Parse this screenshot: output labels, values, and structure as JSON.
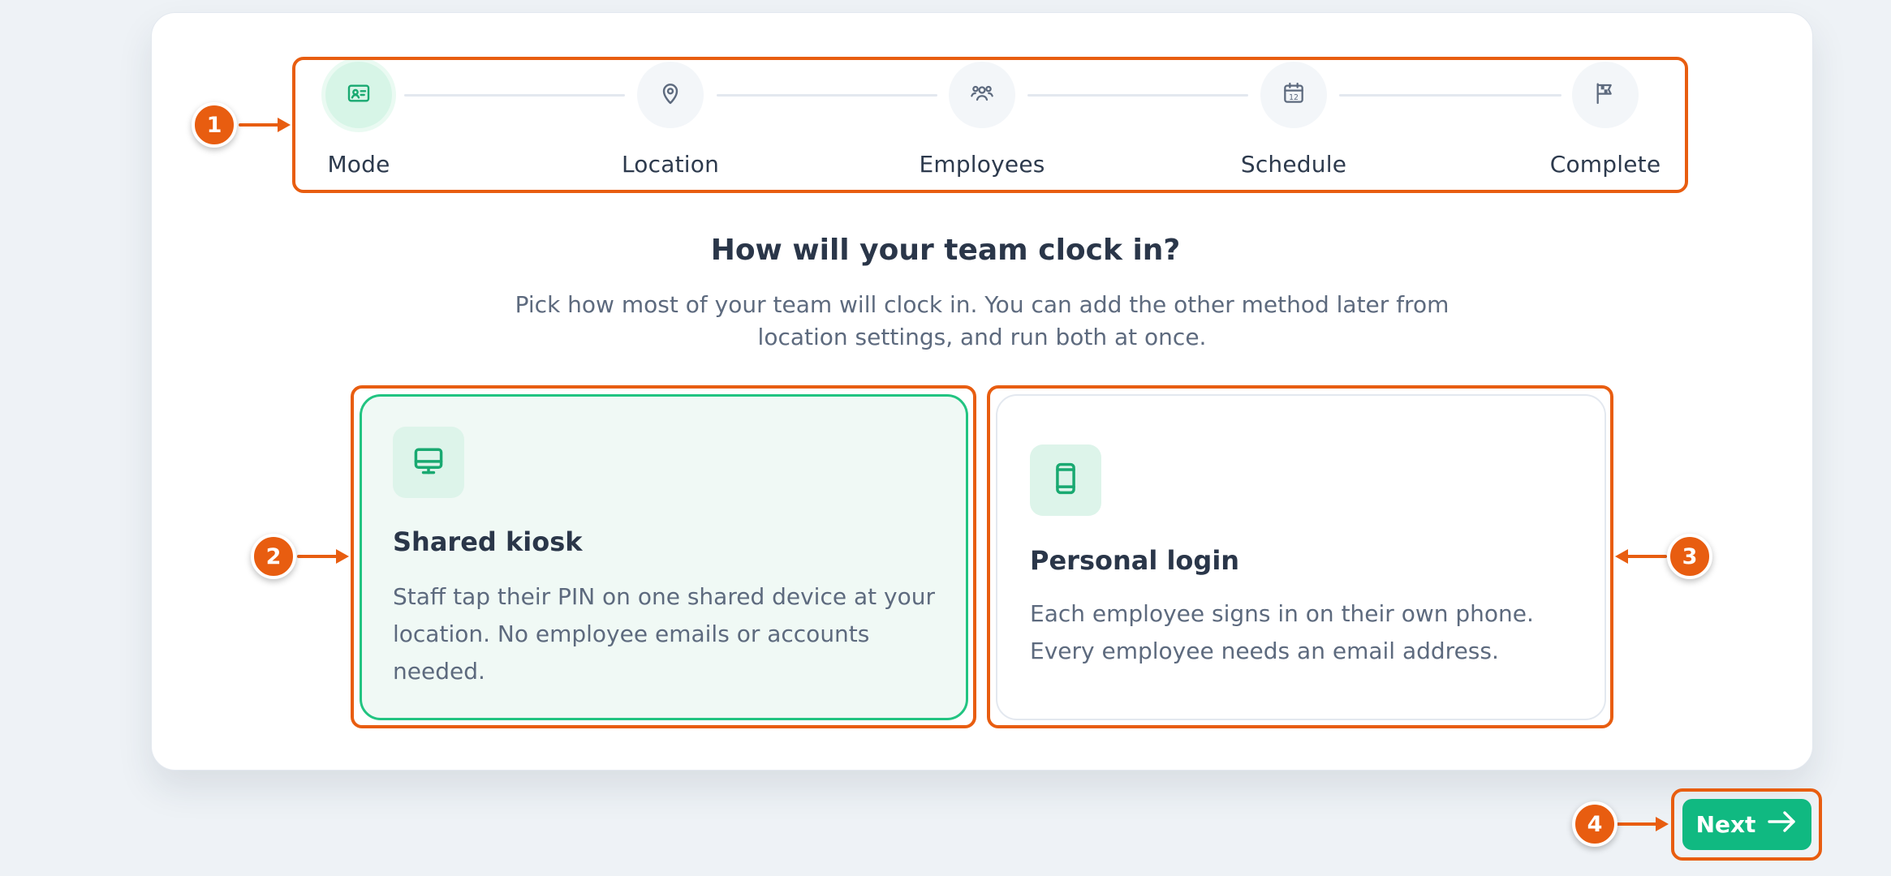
{
  "stepper": {
    "steps": [
      {
        "label": "Mode",
        "icon": "id-card-icon",
        "active": true
      },
      {
        "label": "Location",
        "icon": "map-pin-icon",
        "active": false
      },
      {
        "label": "Employees",
        "icon": "users-icon",
        "active": false
      },
      {
        "label": "Schedule",
        "icon": "calendar-icon",
        "active": false
      },
      {
        "label": "Complete",
        "icon": "flag-icon",
        "active": false
      }
    ],
    "calendar_day": "12"
  },
  "main": {
    "heading": "How will your team clock in?",
    "subtext": "Pick how most of your team will clock in. You can add the other method later from location settings, and run both at once."
  },
  "options": [
    {
      "title": "Shared kiosk",
      "description": "Staff tap their PIN on one shared device at your location. No employee emails or accounts needed.",
      "icon": "monitor-icon",
      "selected": true
    },
    {
      "title": "Personal login",
      "description": "Each employee signs in on their own phone. Every employee needs an email address.",
      "icon": "phone-icon",
      "selected": false
    }
  ],
  "footer": {
    "next_label": "Next"
  },
  "annotations": {
    "badges": [
      "1",
      "2",
      "3",
      "4"
    ]
  },
  "colors": {
    "accent": "#10b981",
    "accent_border": "#22c481",
    "annotation": "#e85d10",
    "text_dark": "#2a3649",
    "text_muted": "#5d6a7e"
  }
}
